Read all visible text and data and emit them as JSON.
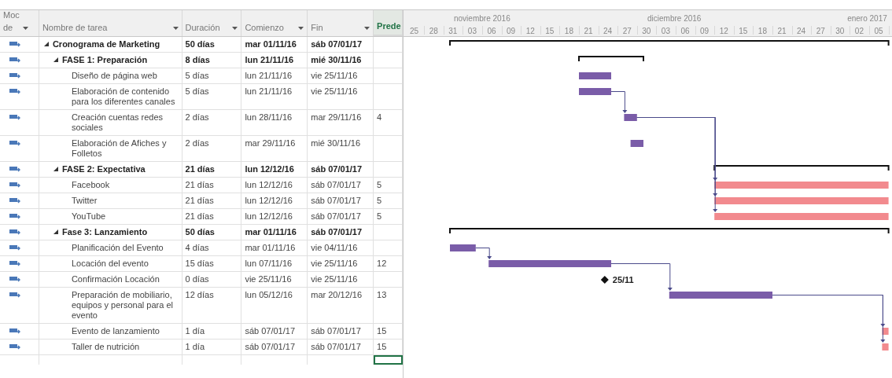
{
  "table": {
    "columns": [
      {
        "label": "Moc de",
        "selected": false
      },
      {
        "label": "Nombre de tarea",
        "selected": false
      },
      {
        "label": "Duración",
        "selected": false
      },
      {
        "label": "Comienzo",
        "selected": false
      },
      {
        "label": "Fin",
        "selected": false
      },
      {
        "label": "Prede",
        "selected": true
      }
    ],
    "tasks": [
      {
        "kind": "summary",
        "name": "Cronograma de Marketing",
        "expanded": true,
        "duration": "50 días",
        "start": "mar 01/11/16",
        "end": "sáb 07/01/17",
        "children": [
          {
            "kind": "summary",
            "name": "FASE 1: Preparación",
            "expanded": true,
            "duration": "8 días",
            "start": "lun 21/11/16",
            "end": "mié 30/11/16",
            "children": [
              {
                "kind": "task",
                "name": "Diseño de página web",
                "duration": "5 días",
                "start": "lun 21/11/16",
                "end": "vie 25/11/16",
                "critical": false
              },
              {
                "kind": "task",
                "name": "Elaboración de contenido para los diferentes canales",
                "duration": "5 días",
                "start": "lun 21/11/16",
                "end": "vie 25/11/16",
                "critical": false
              },
              {
                "kind": "task",
                "name": "Creación cuentas redes sociales",
                "duration": "2 días",
                "start": "lun 28/11/16",
                "end": "mar 29/11/16",
                "predecessor": "4",
                "critical": false
              },
              {
                "kind": "task",
                "name": "Elaboración de Afiches y Folletos",
                "duration": "2 días",
                "start": "mar 29/11/16",
                "end": "mié 30/11/16",
                "critical": false
              }
            ]
          },
          {
            "kind": "summary",
            "name": "FASE 2: Expectativa",
            "expanded": true,
            "duration": "21 días",
            "start": "lun 12/12/16",
            "end": "sáb 07/01/17",
            "children": [
              {
                "kind": "task",
                "name": "Facebook",
                "duration": "21 días",
                "start": "lun 12/12/16",
                "end": "sáb 07/01/17",
                "predecessor": "5",
                "critical": true
              },
              {
                "kind": "task",
                "name": "Twitter",
                "duration": "21 días",
                "start": "lun 12/12/16",
                "end": "sáb 07/01/17",
                "predecessor": "5",
                "critical": true
              },
              {
                "kind": "task",
                "name": "YouTube",
                "duration": "21 días",
                "start": "lun 12/12/16",
                "end": "sáb 07/01/17",
                "predecessor": "5",
                "critical": true
              }
            ]
          },
          {
            "kind": "summary",
            "name": "Fase 3: Lanzamiento",
            "expanded": true,
            "duration": "50 días",
            "start": "mar 01/11/16",
            "end": "sáb 07/01/17",
            "children": [
              {
                "kind": "task",
                "name": "Planificación del Evento",
                "duration": "4 días",
                "start": "mar 01/11/16",
                "end": "vie 04/11/16",
                "critical": false
              },
              {
                "kind": "task",
                "name": "Locación del evento",
                "duration": "15 días",
                "start": "lun 07/11/16",
                "end": "vie 25/11/16",
                "predecessor": "12",
                "critical": false
              },
              {
                "kind": "milestone",
                "name": "Confirmación Locación",
                "duration": "0 días",
                "start": "vie 25/11/16",
                "end": "vie 25/11/16",
                "milestone_label": "25/11"
              },
              {
                "kind": "task",
                "name": "Preparación de mobiliario, equipos y personal para el evento",
                "duration": "12 días",
                "start": "lun 05/12/16",
                "end": "mar 20/12/16",
                "predecessor": "13",
                "critical": false
              },
              {
                "kind": "task",
                "name": "Evento de lanzamiento",
                "duration": "1 día",
                "start": "sáb 07/01/17",
                "end": "sáb 07/01/17",
                "predecessor": "15",
                "critical": true
              },
              {
                "kind": "task",
                "name": "Taller de nutrición",
                "duration": "1 día",
                "start": "sáb 07/01/17",
                "end": "sáb 07/01/17",
                "predecessor": "15",
                "critical": true
              }
            ]
          }
        ]
      }
    ]
  },
  "timescale": {
    "months": [
      "noviembre 2016",
      "diciembre 2016",
      "enero 2017"
    ],
    "days": [
      "25",
      "28",
      "31",
      "03",
      "06",
      "09",
      "12",
      "15",
      "18",
      "21",
      "24",
      "27",
      "30",
      "03",
      "06",
      "09",
      "12",
      "15",
      "18",
      "21",
      "24",
      "27",
      "30",
      "02",
      "05"
    ]
  }
}
